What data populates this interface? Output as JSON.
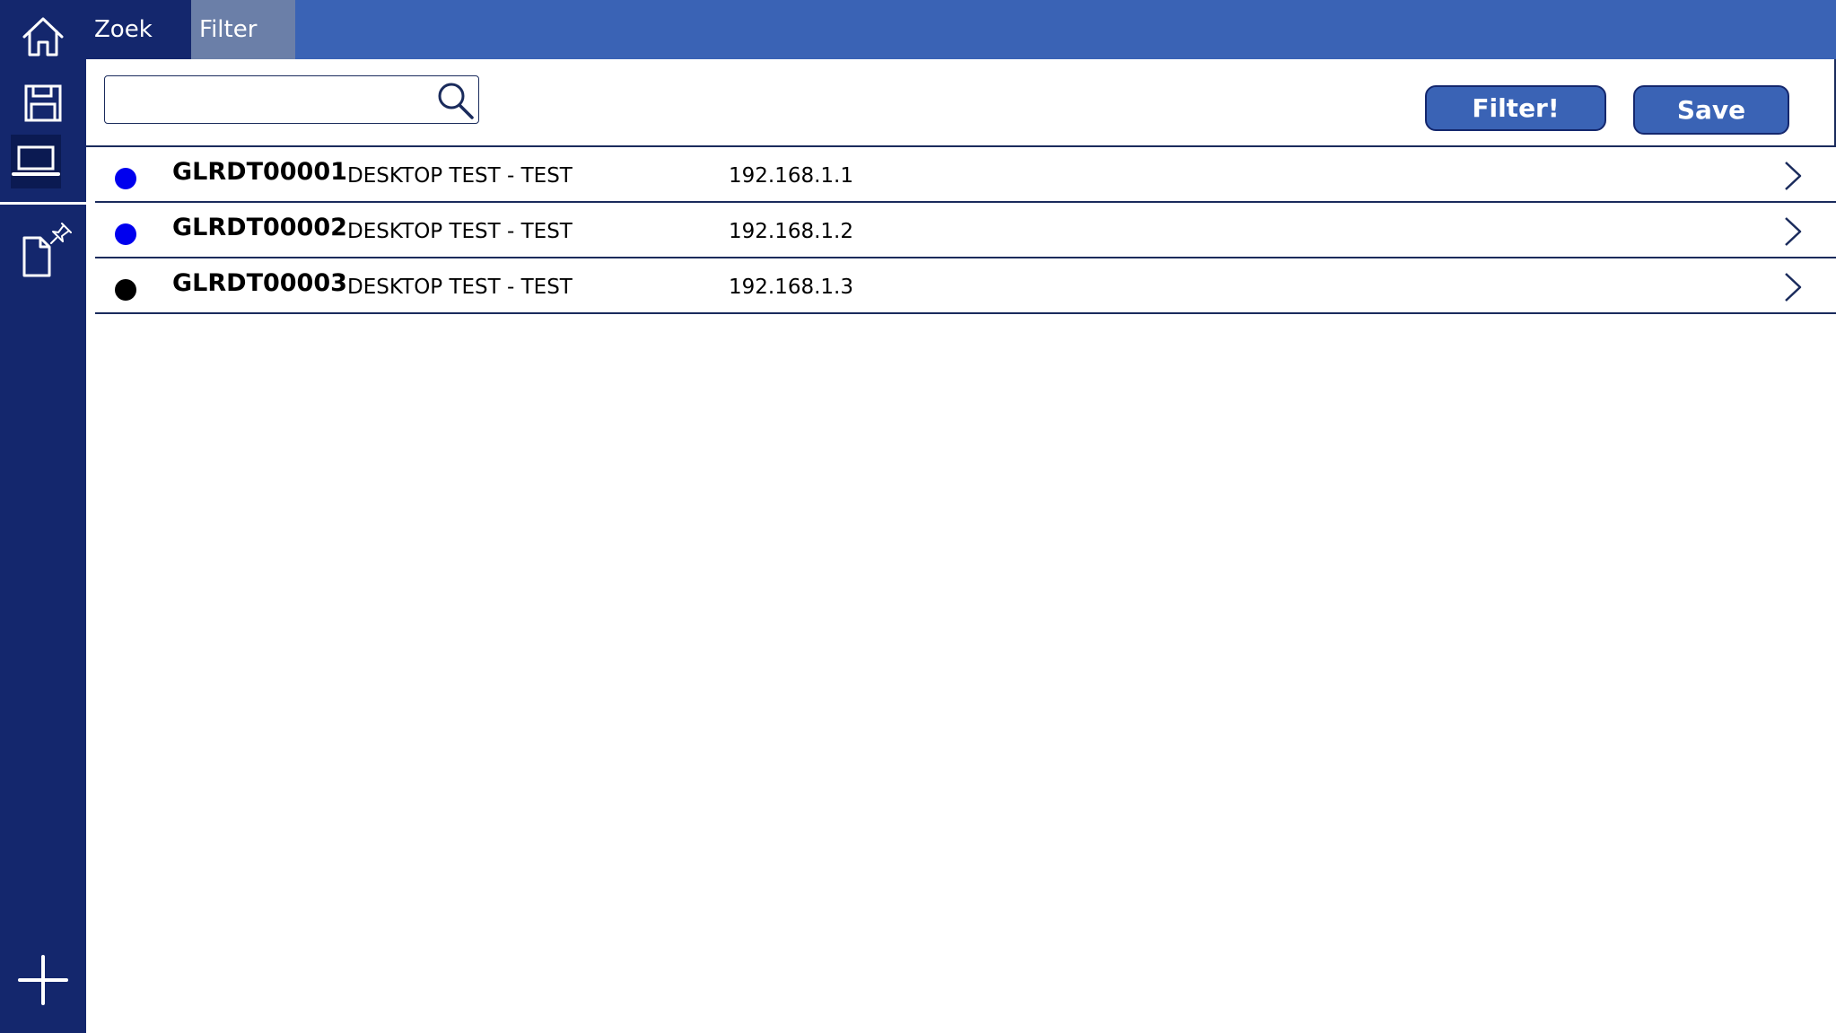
{
  "tabs": {
    "search_label": "Zoek",
    "filter_label": "Filter"
  },
  "nav": {
    "items": [
      {
        "icon": "home-icon"
      },
      {
        "icon": "save-icon"
      },
      {
        "icon": "laptop-icon",
        "selected": true
      },
      {
        "icon": "document-pin-icon"
      },
      {
        "icon": "plus-icon"
      }
    ]
  },
  "search": {
    "value": "",
    "placeholder": ""
  },
  "toolbar": {
    "filter_label": "Filter!",
    "save_label": "Save"
  },
  "devices": [
    {
      "id": "GLRDT00001",
      "description": "DESKTOP TEST - TEST",
      "ip": "192.168.1.1",
      "status_color": "#0000ee"
    },
    {
      "id": "GLRDT00002",
      "description": "DESKTOP TEST - TEST",
      "ip": "192.168.1.2",
      "status_color": "#0000ee"
    },
    {
      "id": "GLRDT00003",
      "description": "DESKTOP TEST - TEST",
      "ip": "192.168.1.3",
      "status_color": "#000000"
    }
  ],
  "colors": {
    "nav_background": "#14276d",
    "header_background": "#3a63b5",
    "filter_tab_background": "#6b7fa8",
    "button_background": "#3a63b5",
    "divider": "#1a2b5c"
  }
}
